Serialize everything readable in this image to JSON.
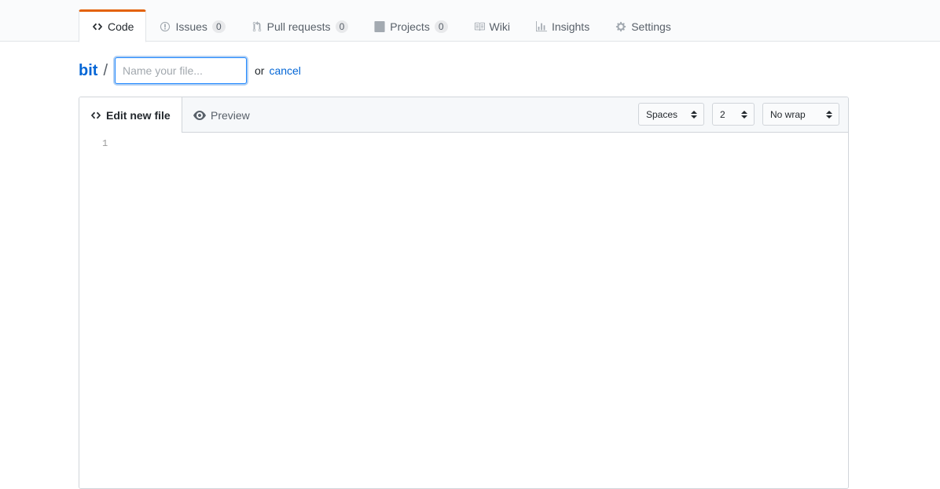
{
  "nav": {
    "tabs": [
      {
        "label": "Code",
        "icon": "code-icon",
        "selected": true
      },
      {
        "label": "Issues",
        "icon": "issue-opened-icon",
        "counter": "0"
      },
      {
        "label": "Pull requests",
        "icon": "git-pull-request-icon",
        "counter": "0"
      },
      {
        "label": "Projects",
        "icon": "project-icon",
        "counter": "0"
      },
      {
        "label": "Wiki",
        "icon": "book-icon"
      },
      {
        "label": "Insights",
        "icon": "graph-icon"
      },
      {
        "label": "Settings",
        "icon": "gear-icon"
      }
    ],
    "accent_color": "#e36209"
  },
  "breadcrumb": {
    "repo": "bit",
    "separator": "/",
    "filename_placeholder": "Name your file...",
    "filename_value": "",
    "or_text": "or",
    "cancel_label": "cancel"
  },
  "editor": {
    "tab_edit": "Edit new file",
    "tab_preview": "Preview",
    "indent_mode": "Spaces",
    "indent_size": "2",
    "wrap_mode": "No wrap",
    "line_numbers": [
      "1"
    ]
  },
  "colors": {
    "link": "#0366d6",
    "border": "#d1d5da",
    "header_bg": "#f6f8fa"
  }
}
